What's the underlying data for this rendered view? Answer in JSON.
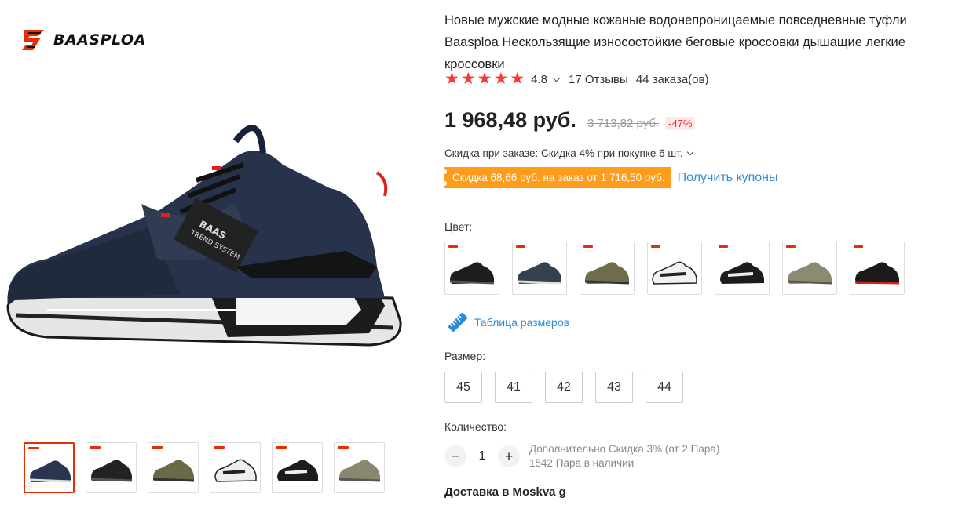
{
  "brand": {
    "name": "BAASPLOA"
  },
  "product": {
    "title": "Новые мужские модные кожаные водонепроницаемые повседневные туфли Baasploa Нескользящие износостойкие беговые кроссовки дышащие легкие кроссовки",
    "rating": "4.8",
    "reviews": "17 Отзывы",
    "orders": "44 заказа(ов)",
    "stars": 5,
    "price": "1 968,48 руб.",
    "old_price": "3 713,82 руб.",
    "discount": "-47%",
    "bulk_discount": "Скидка при заказе: Скидка 4% при покупке 6 шт.",
    "coupon": "Скидка 68,66 руб. на заказ от 1 716,50 руб.",
    "get_coupons": "Получить купоны"
  },
  "color": {
    "label": "Цвет:",
    "options": [
      "black",
      "navy-grey",
      "khaki-green",
      "white-black",
      "black-white",
      "olive-grey",
      "black-red"
    ]
  },
  "size_chart": {
    "label": "Таблица размеров",
    "icon": "ruler-icon"
  },
  "size": {
    "label": "Размер:",
    "options": [
      "45",
      "41",
      "42",
      "43",
      "44"
    ]
  },
  "quantity": {
    "label": "Количество:",
    "value": "1",
    "minus": "−",
    "plus": "+",
    "note_line1": "Дополнительно Скидка 3% (от 2 Пара)",
    "note_line2": "1542 Пара в наличии"
  },
  "delivery": {
    "text": "Доставка в Moskva g"
  },
  "gallery": {
    "thumbnails": 6,
    "active_index": 0
  },
  "colors": {
    "accent": "#e62e04",
    "star": "#f83a3a",
    "coupon_bg": "#ff9c1a",
    "link": "#2e8cd6",
    "discount_text": "#f32727"
  }
}
